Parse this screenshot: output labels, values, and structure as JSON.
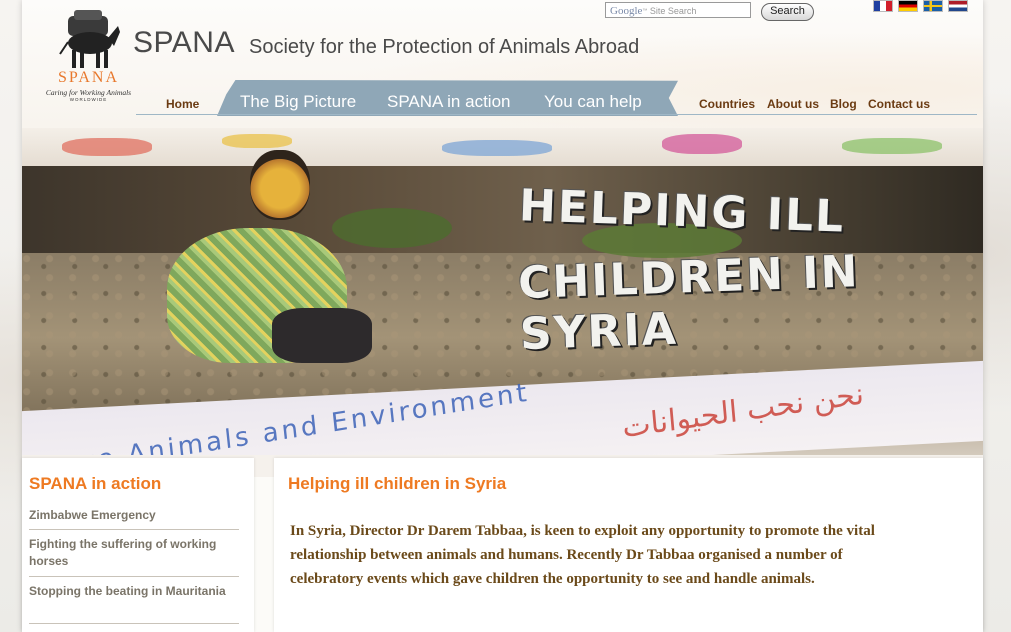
{
  "header": {
    "logo_word": "SPANA",
    "logo_tagline": "Caring for Working Animals",
    "logo_worldwide": "WORLDWIDE",
    "brand": "SPANA",
    "brand_full": "Society for the Protection of Animals Abroad"
  },
  "search": {
    "google_word": "Google",
    "placeholder": "Site Search",
    "button_label": "Search"
  },
  "flags": [
    {
      "name": "France",
      "colors": [
        "#1f3fa0",
        "#ffffff",
        "#d11f2b"
      ]
    },
    {
      "name": "Germany",
      "colors": [
        "#000000",
        "#dd0000",
        "#ffcc00"
      ]
    },
    {
      "name": "Sweden",
      "colors": [
        "#1a5fa8",
        "#f5c518"
      ]
    },
    {
      "name": "Netherlands",
      "colors": [
        "#ae1c28",
        "#ffffff",
        "#21468b"
      ]
    }
  ],
  "nav": {
    "home": "Home",
    "main": [
      "The Big Picture",
      "SPANA in action",
      "You can help"
    ],
    "right": [
      "Countries",
      "About us",
      "Blog",
      "Contact us"
    ]
  },
  "hero": {
    "headline_line1": "HELPING ILL",
    "headline_line2": "CHILDREN IN SYRIA",
    "banner_text": "e Love Animals and Environment",
    "banner_arabic": "نحن نحب الحيوانات"
  },
  "sidebar": {
    "title": "SPANA in action",
    "items": [
      "Zimbabwe Emergency",
      "Fighting the suffering of working horses",
      "Stopping the beating in Mauritania"
    ]
  },
  "main": {
    "title": "Helping ill children in Syria",
    "body": "In Syria, Director Dr Darem Tabbaa, is keen to exploit any opportunity to promote the vital relationship between animals and humans. Recently Dr Tabbaa organised a number of celebratory events which gave children the opportunity to see and handle animals."
  },
  "colors": {
    "accent_orange": "#ee7a22",
    "nav_brown": "#6b3b12",
    "nav_band_blue": "#8fa7b7",
    "body_text": "#6b4a1a"
  }
}
